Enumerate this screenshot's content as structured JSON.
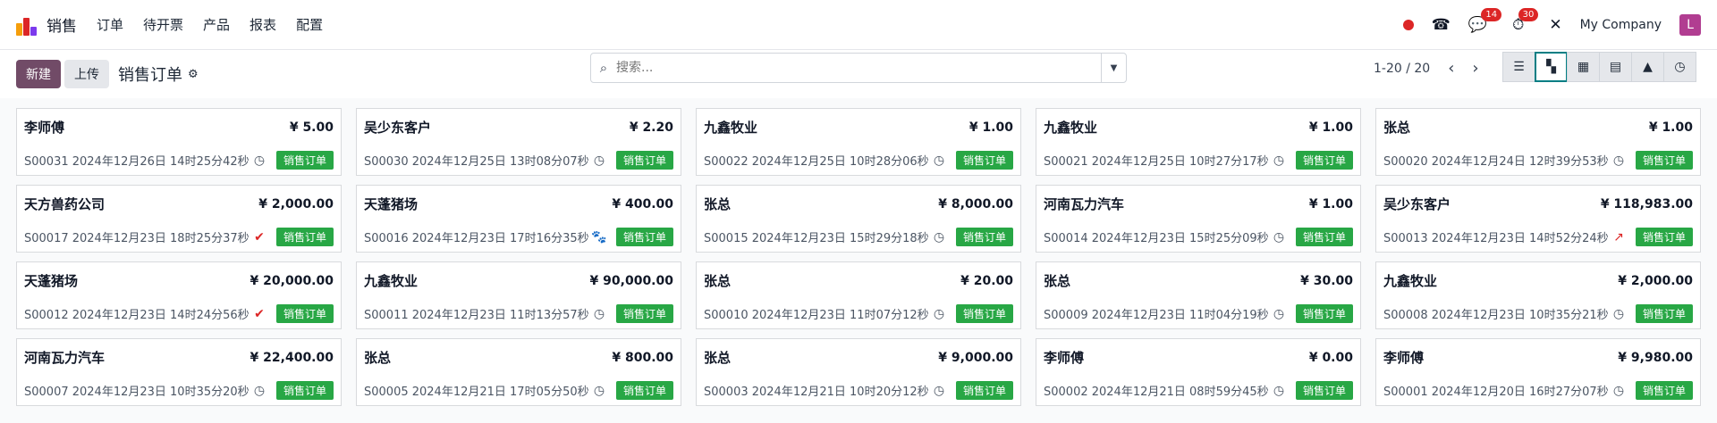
{
  "app": {
    "name": "销售"
  },
  "menu": [
    "订单",
    "待开票",
    "产品",
    "报表",
    "配置"
  ],
  "topright": {
    "chat_badge": "14",
    "activity_badge": "30",
    "company": "My Company",
    "avatar": "L"
  },
  "controls": {
    "new_label": "新建",
    "upload_label": "上传",
    "title": "销售订单",
    "search_placeholder": "搜索...",
    "pager": "1-20 / 20"
  },
  "view_icons": [
    "list-icon",
    "kanban-icon",
    "calendar-icon",
    "pivot-icon",
    "graph-icon",
    "activity-icon"
  ],
  "colors": {
    "brand": "#714b67",
    "tag_green": "#28a745",
    "accent_teal": "#017e84",
    "alert_red": "#dc2626"
  },
  "cards": [
    {
      "customer": "李师傅",
      "amount": "¥ 5.00",
      "ref": "S00031 2024年12月26日 14时25分42秒",
      "activity": "clock",
      "tag": "销售订单"
    },
    {
      "customer": "吴少东客户",
      "amount": "¥ 2.20",
      "ref": "S00030 2024年12月25日 13时08分07秒",
      "activity": "clock",
      "tag": "销售订单"
    },
    {
      "customer": "九鑫牧业",
      "amount": "¥ 1.00",
      "ref": "S00022 2024年12月25日 10时28分06秒",
      "activity": "clock",
      "tag": "销售订单"
    },
    {
      "customer": "九鑫牧业",
      "amount": "¥ 1.00",
      "ref": "S00021 2024年12月25日 10时27分17秒",
      "activity": "clock",
      "tag": "销售订单"
    },
    {
      "customer": "张总",
      "amount": "¥ 1.00",
      "ref": "S00020 2024年12月24日 12时39分53秒",
      "activity": "clock",
      "tag": "销售订单"
    },
    {
      "customer": "天方兽药公司",
      "amount": "¥ 2,000.00",
      "ref": "S00017 2024年12月23日 18时25分37秒",
      "activity": "check",
      "tag": "销售订单"
    },
    {
      "customer": "天蓬猪场",
      "amount": "¥ 400.00",
      "ref": "S00016 2024年12月23日 17时16分35秒",
      "activity": "paw",
      "tag": "销售订单"
    },
    {
      "customer": "张总",
      "amount": "¥ 8,000.00",
      "ref": "S00015 2024年12月23日 15时29分18秒",
      "activity": "clock",
      "tag": "销售订单"
    },
    {
      "customer": "河南瓦力汽车",
      "amount": "¥ 1.00",
      "ref": "S00014 2024年12月23日 15时25分09秒",
      "activity": "clock",
      "tag": "销售订单"
    },
    {
      "customer": "吴少东客户",
      "amount": "¥ 118,983.00",
      "ref": "S00013 2024年12月23日 14时52分24秒",
      "activity": "trend",
      "tag": "销售订单"
    },
    {
      "customer": "天蓬猪场",
      "amount": "¥ 20,000.00",
      "ref": "S00012 2024年12月23日 14时24分56秒",
      "activity": "check",
      "tag": "销售订单"
    },
    {
      "customer": "九鑫牧业",
      "amount": "¥ 90,000.00",
      "ref": "S00011 2024年12月23日 11时13分57秒",
      "activity": "clock",
      "tag": "销售订单"
    },
    {
      "customer": "张总",
      "amount": "¥ 20.00",
      "ref": "S00010 2024年12月23日 11时07分12秒",
      "activity": "clock",
      "tag": "销售订单"
    },
    {
      "customer": "张总",
      "amount": "¥ 30.00",
      "ref": "S00009 2024年12月23日 11时04分19秒",
      "activity": "clock",
      "tag": "销售订单"
    },
    {
      "customer": "九鑫牧业",
      "amount": "¥ 2,000.00",
      "ref": "S00008 2024年12月23日 10时35分21秒",
      "activity": "clock",
      "tag": "销售订单"
    },
    {
      "customer": "河南瓦力汽车",
      "amount": "¥ 22,400.00",
      "ref": "S00007 2024年12月23日 10时35分20秒",
      "activity": "clock",
      "tag": "销售订单"
    },
    {
      "customer": "张总",
      "amount": "¥ 800.00",
      "ref": "S00005 2024年12月21日 17时05分50秒",
      "activity": "clock",
      "tag": "销售订单"
    },
    {
      "customer": "张总",
      "amount": "¥ 9,000.00",
      "ref": "S00003 2024年12月21日 10时20分12秒",
      "activity": "clock",
      "tag": "销售订单"
    },
    {
      "customer": "李师傅",
      "amount": "¥ 0.00",
      "ref": "S00002 2024年12月21日 08时59分45秒",
      "activity": "clock",
      "tag": "销售订单"
    },
    {
      "customer": "李师傅",
      "amount": "¥ 9,980.00",
      "ref": "S00001 2024年12月20日 16时27分07秒",
      "activity": "clock",
      "tag": "销售订单"
    }
  ]
}
